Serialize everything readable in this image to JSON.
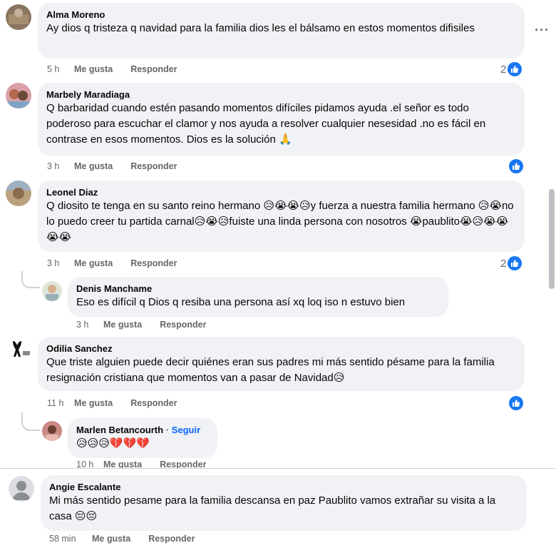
{
  "comments": [
    {
      "author": "Alma Moreno",
      "text": "Ay dios q tristeza q navidad para la familia dios les el bálsamo en estos momentos difisiles",
      "time": "5 h",
      "like_label": "Me gusta",
      "reply_label": "Responder",
      "reaction_count": "2"
    },
    {
      "author": "Marbely Maradiaga",
      "text": "Q barbaridad cuando estén pasando momentos difíciles pidamos ayuda .el señor es todo poderoso para escuchar el clamor y nos ayuda a resolver cualquier nesesidad .no es fácil en contrase en esos momentos. Dios es la solución 🙏",
      "time": "3 h",
      "like_label": "Me gusta",
      "reply_label": "Responder",
      "reaction_count": ""
    },
    {
      "author": "Leonel Diaz",
      "text": "Q diosito te tenga en su santo reino hermano 😥😭😭😥y fuerza a nuestra familia hermano 😥😭no lo puedo creer tu partida carnal😥😭😥fuiste una linda persona con nosotros 😭paublito😭😥😭😭😭😭",
      "time": "3 h",
      "like_label": "Me gusta",
      "reply_label": "Responder",
      "reaction_count": "2"
    },
    {
      "author": "Denis Manchame",
      "text": "Eso es difícil q Dios q resiba una persona así xq loq iso n estuvo bien",
      "time": "3 h",
      "like_label": "Me gusta",
      "reply_label": "Responder"
    },
    {
      "author": "Odilia Sanchez",
      "text": "Que triste alguien puede decir quiénes eran sus padres mi más sentido pésame para la familia resignación cristiana que momentos van a pasar de Navidad😥",
      "time": "11 h",
      "like_label": "Me gusta",
      "reply_label": "Responder"
    },
    {
      "author": "Marlen Betancourth",
      "separator": "·",
      "follow_label": "Seguir",
      "text": "😥😥😥💔💔💔",
      "time": "10 h",
      "like_label": "Me gusta",
      "reply_label": "Responder"
    },
    {
      "author": "Angie Escalante",
      "text": "Mi más sentido pesame para la familia descansa en paz Paublito vamos extrañar su visita a la casa 😔😔",
      "time": "58 min",
      "like_label": "Me gusta",
      "reply_label": "Responder"
    }
  ],
  "more_options": "···",
  "colors": {
    "bubble": "#f0f2f5",
    "meta_text": "#65676b",
    "like_blue": "#1877f2",
    "follow_blue": "#0866ff"
  },
  "icons": [
    "like-icon",
    "more-options-icon",
    "avatar-icon",
    "default-avatar-icon"
  ]
}
